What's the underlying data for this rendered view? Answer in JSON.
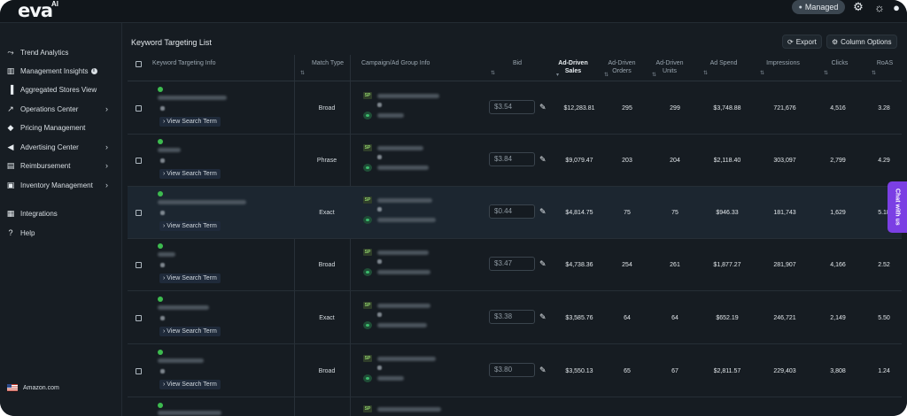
{
  "app": {
    "logo_text": "eva",
    "logo_sup": "AI"
  },
  "topbar": {
    "mode_pill": "Managed",
    "icons": [
      "gear-icon",
      "sun-icon",
      "user-icon"
    ]
  },
  "sidebar": {
    "items": [
      {
        "label": "Trend Analytics",
        "icon": "trend-icon",
        "chevron": false
      },
      {
        "label": "Management Insights",
        "icon": "bar-chart-icon",
        "chevron": false,
        "info": true
      },
      {
        "label": "Aggregated Stores View",
        "icon": "bars-icon",
        "chevron": false
      },
      {
        "label": "Operations Center",
        "icon": "line-up-icon",
        "chevron": true
      },
      {
        "label": "Pricing Management",
        "icon": "tag-icon",
        "chevron": false
      },
      {
        "label": "Advertising Center",
        "icon": "megaphone-icon",
        "chevron": true
      },
      {
        "label": "Reimbursement",
        "icon": "receipt-icon",
        "chevron": true
      },
      {
        "label": "Inventory Management",
        "icon": "box-icon",
        "chevron": true
      },
      {
        "label": "Integrations",
        "icon": "plug-icon",
        "chevron": false
      },
      {
        "label": "Help",
        "icon": "help-icon",
        "chevron": false
      }
    ],
    "marketplace": "Amazon.com"
  },
  "main": {
    "title": "Keyword Targeting List",
    "export_label": "Export",
    "column_options_label": "Column Options",
    "columns": {
      "keyword": "Keyword Targeting Info",
      "match": "Match Type",
      "campaign": "Campaign/Ad Group Info",
      "bid": "Bid",
      "sales": "Ad-Driven Sales",
      "orders": "Ad-Driven Orders",
      "units": "Ad-Driven Units",
      "spend": "Ad Spend",
      "impressions": "Impressions",
      "clicks": "Clicks",
      "roas": "RoAS"
    },
    "view_search_term_label": "View Search Term",
    "rows": [
      {
        "match": "Broad",
        "bid": "$3.54",
        "sales": "$12,283.81",
        "orders": "295",
        "units": "299",
        "spend": "$3,748.88",
        "impressions": "721,676",
        "clicks": "4,516",
        "roas": "3.28"
      },
      {
        "match": "Phrase",
        "bid": "$3.84",
        "sales": "$9,079.47",
        "orders": "203",
        "units": "204",
        "spend": "$2,118.40",
        "impressions": "303,097",
        "clicks": "2,799",
        "roas": "4.29"
      },
      {
        "match": "Exact",
        "bid": "$0.44",
        "sales": "$4,814.75",
        "orders": "75",
        "units": "75",
        "spend": "$946.33",
        "impressions": "181,743",
        "clicks": "1,629",
        "roas": "5.18"
      },
      {
        "match": "Broad",
        "bid": "$3.47",
        "sales": "$4,738.36",
        "orders": "254",
        "units": "261",
        "spend": "$1,877.27",
        "impressions": "281,907",
        "clicks": "4,166",
        "roas": "2.52"
      },
      {
        "match": "Exact",
        "bid": "$3.38",
        "sales": "$3,585.76",
        "orders": "64",
        "units": "64",
        "spend": "$652.19",
        "impressions": "246,721",
        "clicks": "2,149",
        "roas": "5.50"
      },
      {
        "match": "Broad",
        "bid": "$3.80",
        "sales": "$3,550.13",
        "orders": "65",
        "units": "67",
        "spend": "$2,811.57",
        "impressions": "229,403",
        "clicks": "3,808",
        "roas": "1.24"
      }
    ]
  },
  "chat_tab": "Chat with us"
}
